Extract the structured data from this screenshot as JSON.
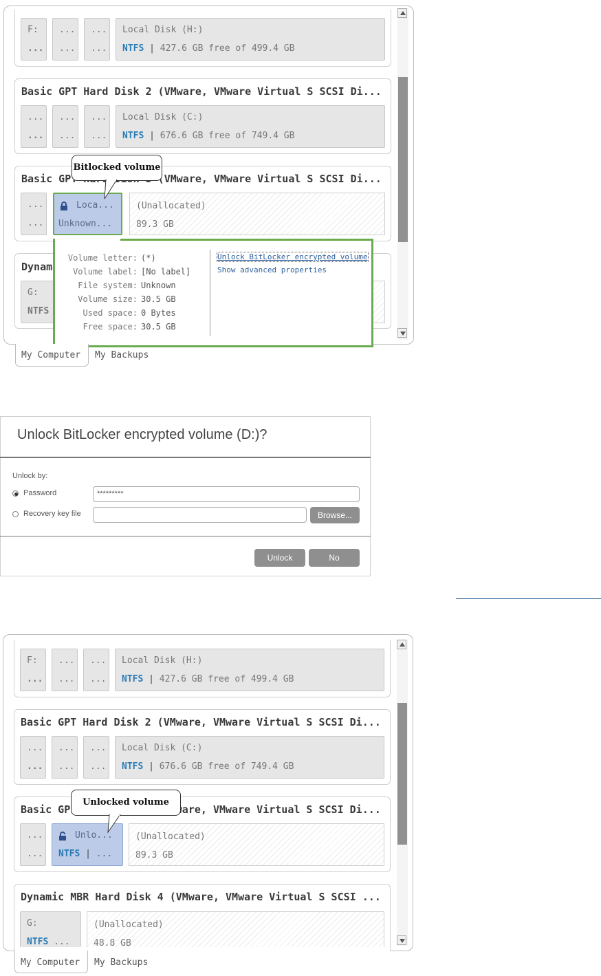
{
  "top_panel": {
    "row1": {
      "small_vols": [
        {
          "l1": "F:",
          "l2": "..."
        },
        {
          "l1": "...",
          "l2": "..."
        },
        {
          "l1": "...",
          "l2": "..."
        }
      ],
      "main_vol": {
        "name": "Local Disk (H:)",
        "fs": "NTFS",
        "sep": "|",
        "space": "427.6 GB free of 499.4 GB"
      }
    },
    "disk2": {
      "title": "Basic GPT Hard Disk 2 (VMware, VMware Virtual S SCSI Di...",
      "small_vols": [
        {
          "l1": "...",
          "l2": "..."
        },
        {
          "l1": "...",
          "l2": "..."
        },
        {
          "l1": "...",
          "l2": "..."
        }
      ],
      "main_vol": {
        "name": "Local Disk (C:)",
        "fs": "NTFS",
        "sep": "|",
        "space": "676.6 GB free of 749.4 GB"
      }
    },
    "disk3": {
      "title": "Basic GPT Hard Disk 3 (VMware, VMware Virtual S SCSI Di...",
      "small_vol": {
        "l1": "...",
        "l2": "..."
      },
      "locked_vol": {
        "l1": "Loca...",
        "l2": "Unknown..."
      },
      "unalloc": {
        "l1": "(Unallocated)",
        "l2": "89.3 GB"
      }
    },
    "disk4": {
      "title_partial": "Dynam",
      "vol": {
        "l1": "G:",
        "l2": "NTFS"
      }
    },
    "callout": "Bitlocked volume",
    "popup": {
      "props": [
        {
          "label": "Volume letter:",
          "value": "(*)"
        },
        {
          "label": "Volume label:",
          "value": "[No label]"
        },
        {
          "label": "File system:",
          "value": "Unknown"
        },
        {
          "label": "Volume size:",
          "value": "30.5 GB"
        },
        {
          "label": "Used space:",
          "value": "0 Bytes"
        },
        {
          "label": "Free space:",
          "value": "30.5 GB"
        }
      ],
      "link_unlock": "Unlock BitLocker encrypted volume",
      "link_advanced": "Show advanced properties"
    },
    "tabs": {
      "my_computer": "My Computer",
      "my_backups": "My Backups"
    }
  },
  "dialog": {
    "title": "Unlock BitLocker encrypted volume (D:)?",
    "unlock_by": "Unlock by:",
    "password_label": "Password",
    "password_value": "*********",
    "recovery_label": "Recovery key file",
    "recovery_value": "",
    "browse": "Browse...",
    "unlock": "Unlock",
    "no": "No"
  },
  "bottom_panel": {
    "row1": {
      "small_vols": [
        {
          "l1": "F:",
          "l2": "..."
        },
        {
          "l1": "...",
          "l2": "..."
        },
        {
          "l1": "...",
          "l2": "..."
        }
      ],
      "main_vol": {
        "name": "Local Disk (H:)",
        "fs": "NTFS",
        "sep": "|",
        "space": "427.6 GB free of 499.4 GB"
      }
    },
    "disk2": {
      "title": "Basic GPT Hard Disk 2 (VMware, VMware Virtual S SCSI Di...",
      "small_vols": [
        {
          "l1": "...",
          "l2": "..."
        },
        {
          "l1": "...",
          "l2": "..."
        },
        {
          "l1": "...",
          "l2": "..."
        }
      ],
      "main_vol": {
        "name": "Local Disk (C:)",
        "fs": "NTFS",
        "sep": "|",
        "space": "676.6 GB free of 749.4 GB"
      }
    },
    "disk3": {
      "title": "Basic GPT Hard Disk 3 (VMware, VMware Virtual S SCSI Di...",
      "small_vol": {
        "l1": "...",
        "l2": "..."
      },
      "unlocked_vol": {
        "l1": "Unlo...",
        "fs": "NTFS",
        "sep": "|",
        "rest": "..."
      },
      "unalloc": {
        "l1": "(Unallocated)",
        "l2": "89.3 GB"
      }
    },
    "disk4": {
      "title": "Dynamic MBR Hard Disk 4 (VMware, VMware Virtual S SCSI ...",
      "vol": {
        "l1": "G:",
        "fs": "NTFS",
        "rest": "..."
      },
      "unalloc": {
        "l1": "(Unallocated)",
        "l2": "48.8 GB"
      }
    },
    "callout": "Unlocked volume",
    "tabs": {
      "my_computer": "My Computer",
      "my_backups": "My Backups"
    }
  },
  "colors": {
    "accent_green": "#6aab4f",
    "fs_blue": "#2a7bb5",
    "selected_bg": "#bccbe8",
    "button_gray": "#8f8f8f"
  }
}
